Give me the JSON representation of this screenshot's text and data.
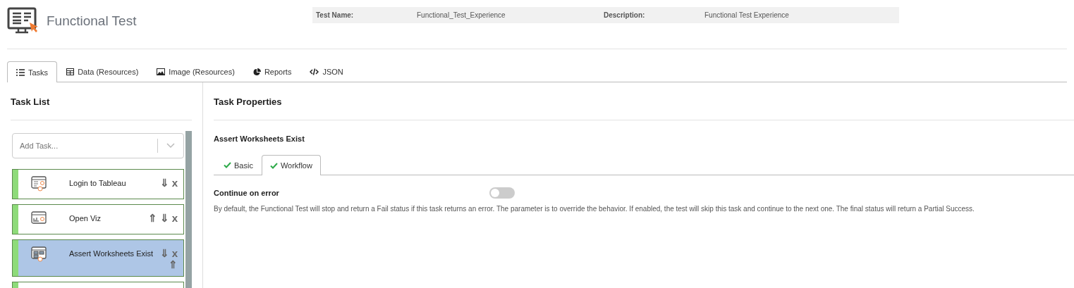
{
  "header": {
    "title": "Functional Test",
    "info": [
      {
        "label": "Test Name:",
        "value": "Functional_Test_Experience"
      },
      {
        "label": "Description:",
        "value": "Functional Test Experience"
      }
    ]
  },
  "tabs": [
    {
      "label": "Tasks",
      "selected": true
    },
    {
      "label": "Data (Resources)",
      "selected": false
    },
    {
      "label": "Image (Resources)",
      "selected": false
    },
    {
      "label": "Reports",
      "selected": false
    },
    {
      "label": "JSON",
      "selected": false
    }
  ],
  "task_list": {
    "title": "Task List",
    "add_placeholder": "Add Task...",
    "tasks": [
      {
        "label": "Login to Tableau",
        "selected": false,
        "actions": [
          "⇓",
          "x"
        ]
      },
      {
        "label": "Open Viz",
        "selected": false,
        "actions": [
          "⇑",
          "⇓",
          "x"
        ]
      },
      {
        "label": "Assert Worksheets Exist",
        "selected": true,
        "actions": [
          "⇓",
          "x"
        ],
        "extra_actions": [
          "⇑"
        ]
      }
    ]
  },
  "properties": {
    "title": "Task Properties",
    "task_name": "Assert Worksheets Exist",
    "tabs": [
      {
        "label": "Basic",
        "selected": false
      },
      {
        "label": "Workflow",
        "selected": true
      }
    ],
    "setting": {
      "label": "Continue on error",
      "on": false,
      "description": "By default, the Functional Test will stop and return a Fail status if this task returns an error. The parameter is to override the behavior. If enabled, the test will skip this task and continue to the next one. The final status will return a Partial Success."
    }
  }
}
